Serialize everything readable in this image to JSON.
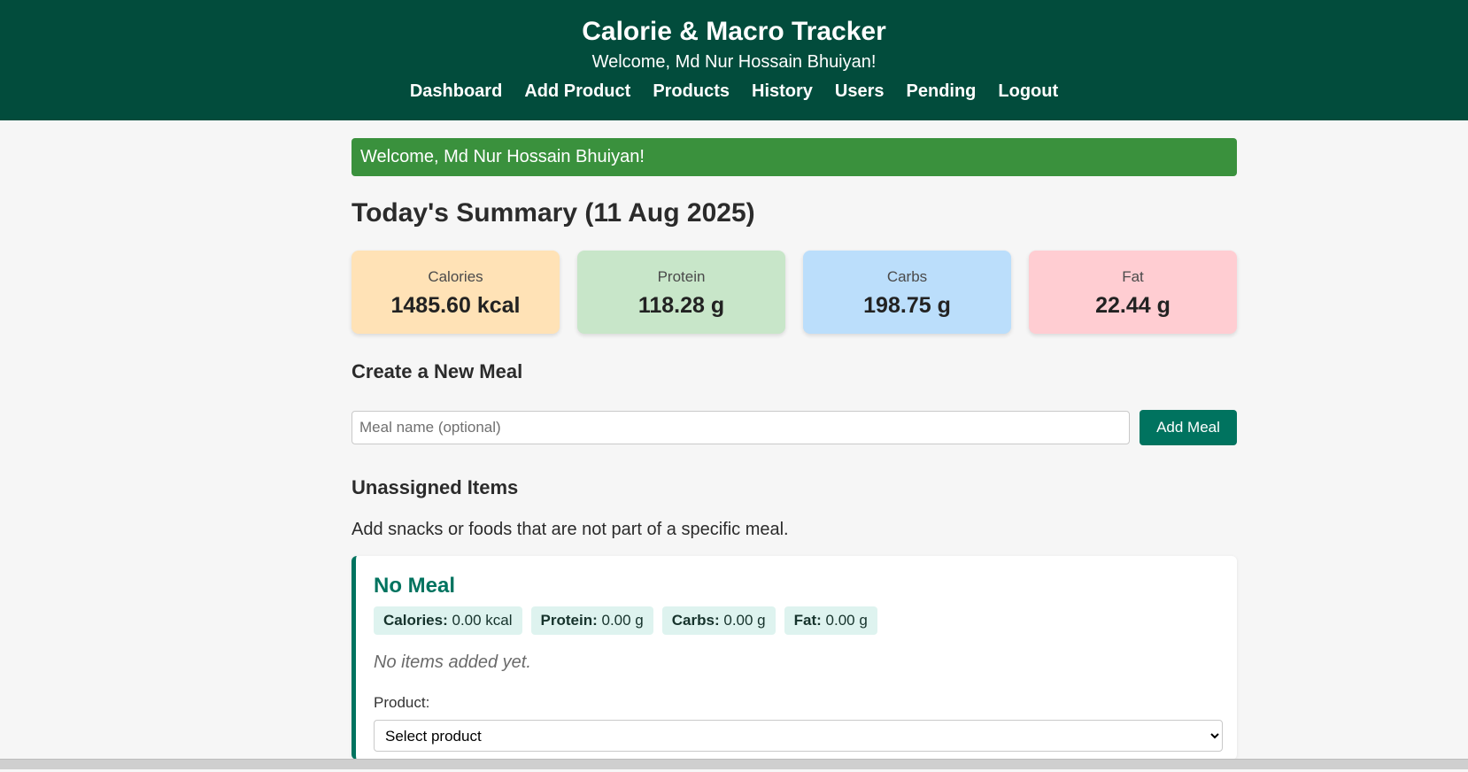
{
  "header": {
    "title": "Calorie & Macro Tracker",
    "welcome": "Welcome, Md Nur Hossain Bhuiyan!",
    "nav": [
      "Dashboard",
      "Add Product",
      "Products",
      "History",
      "Users",
      "Pending",
      "Logout"
    ]
  },
  "alert": {
    "text": "Welcome, Md Nur Hossain Bhuiyan!",
    "color": "#3a913d"
  },
  "summary": {
    "title": "Today's Summary (11 Aug 2025)",
    "cards": [
      {
        "label": "Calories",
        "value": "1485.60 kcal",
        "color": "#ffe2b6"
      },
      {
        "label": "Protein",
        "value": "118.28 g",
        "color": "#c8e6c9"
      },
      {
        "label": "Carbs",
        "value": "198.75 g",
        "color": "#bbdefb"
      },
      {
        "label": "Fat",
        "value": "22.44 g",
        "color": "#ffcdd2"
      }
    ]
  },
  "create_meal": {
    "title": "Create a New Meal",
    "input_placeholder": "Meal name (optional)",
    "button_label": "Add Meal"
  },
  "unassigned": {
    "title": "Unassigned Items",
    "description": "Add snacks or foods that are not part of a specific meal.",
    "meal": {
      "name": "No Meal",
      "macros": [
        {
          "label": "Calories:",
          "value": "0.00 kcal"
        },
        {
          "label": "Protein:",
          "value": "0.00 g"
        },
        {
          "label": "Carbs:",
          "value": "0.00 g"
        },
        {
          "label": "Fat:",
          "value": "0.00 g"
        }
      ],
      "empty_message": "No items added yet.",
      "product_label": "Product:",
      "product_selected": "Select product"
    }
  },
  "colors": {
    "header_bg": "#024c3c",
    "accent": "#00735f"
  }
}
